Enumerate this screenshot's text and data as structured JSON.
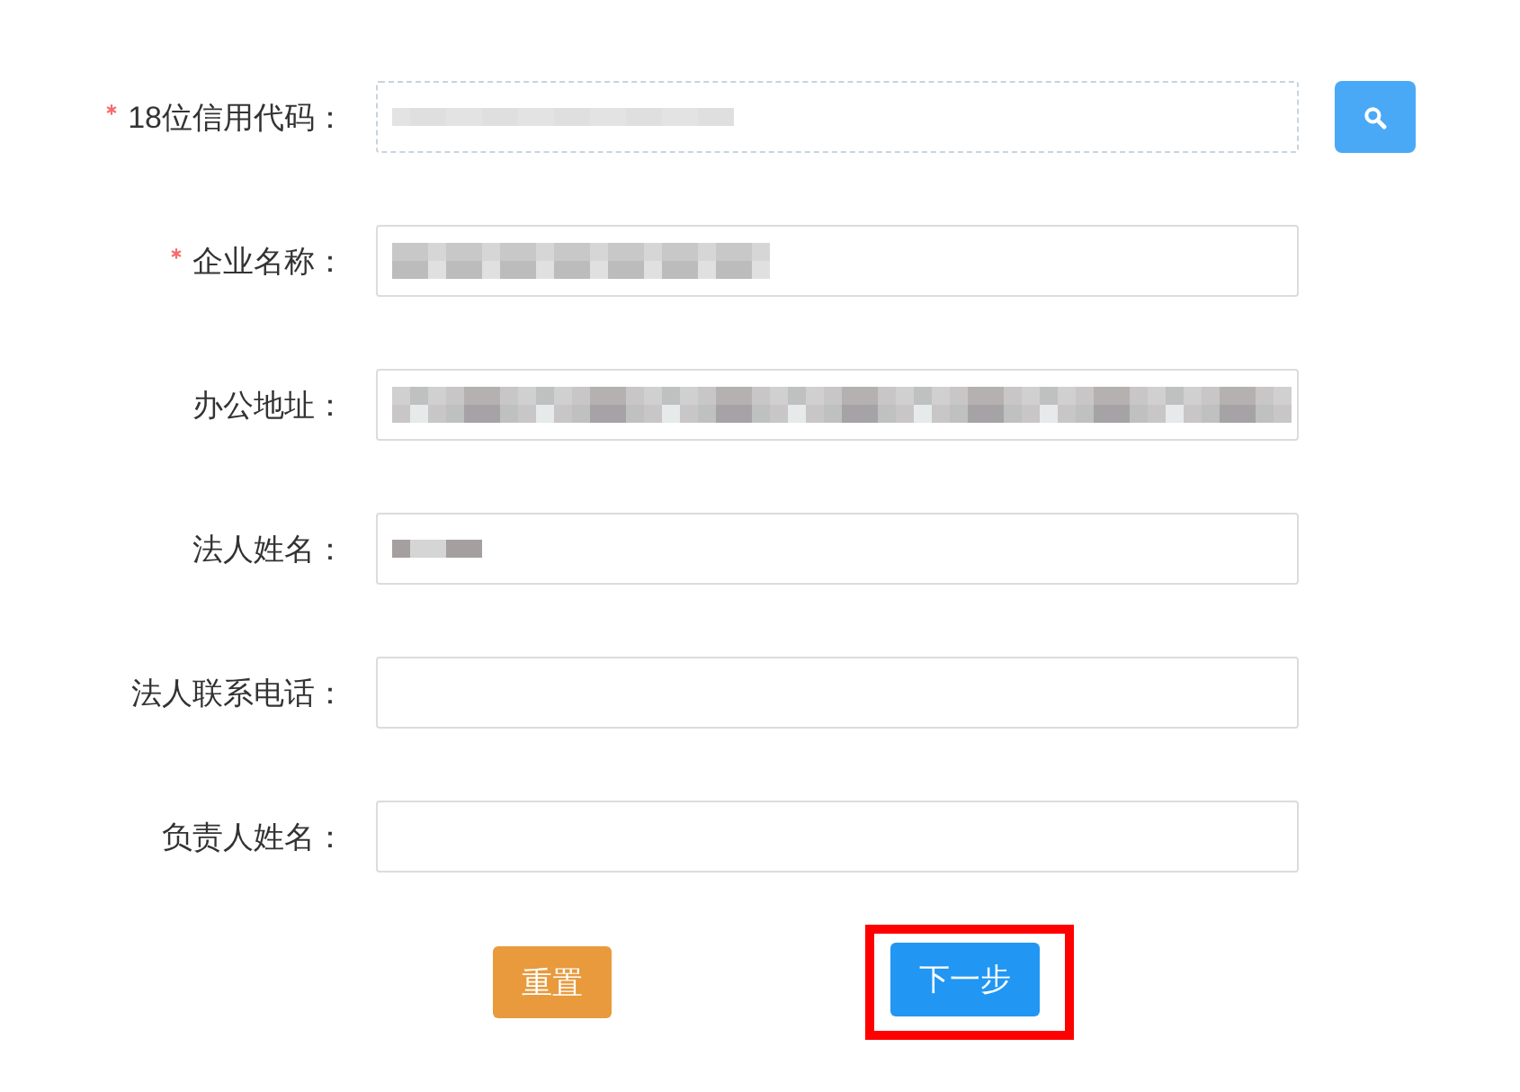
{
  "form": {
    "fields": [
      {
        "label": "18位信用代码：",
        "required": true,
        "readonly": true,
        "redacted": true,
        "has_search": true
      },
      {
        "label": "企业名称：",
        "required": true,
        "readonly": false,
        "redacted": true,
        "has_search": false
      },
      {
        "label": "办公地址：",
        "required": false,
        "readonly": false,
        "redacted": true,
        "has_search": false
      },
      {
        "label": "法人姓名：",
        "required": false,
        "readonly": false,
        "redacted": true,
        "has_search": false
      },
      {
        "label": "法人联系电话：",
        "required": false,
        "readonly": false,
        "redacted": false,
        "has_search": false
      },
      {
        "label": "负责人姓名：",
        "required": false,
        "readonly": false,
        "redacted": false,
        "has_search": false
      }
    ],
    "buttons": [
      {
        "label": "重置",
        "kind": "reset",
        "highlighted": false
      },
      {
        "label": "下一步",
        "kind": "primary",
        "highlighted": true
      }
    ]
  }
}
